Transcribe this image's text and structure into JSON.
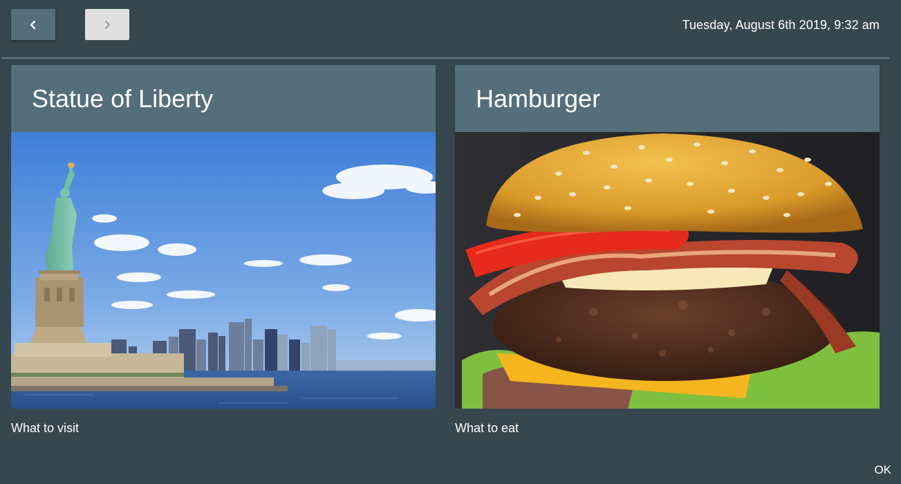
{
  "header": {
    "back_icon": "chevron-left-icon",
    "forward_icon": "chevron-right-icon",
    "datetime": "Tuesday, August 6th 2019, 9:32 am"
  },
  "cards": [
    {
      "title": "Statue of Liberty",
      "caption": "What to visit"
    },
    {
      "title": "Hamburger",
      "caption": "What to eat"
    }
  ],
  "footer": {
    "ok_label": "OK"
  },
  "colors": {
    "background": "#37474f",
    "card_header": "#546e7a",
    "back_button": "#546e7a",
    "forward_button": "#e0e0e0"
  }
}
